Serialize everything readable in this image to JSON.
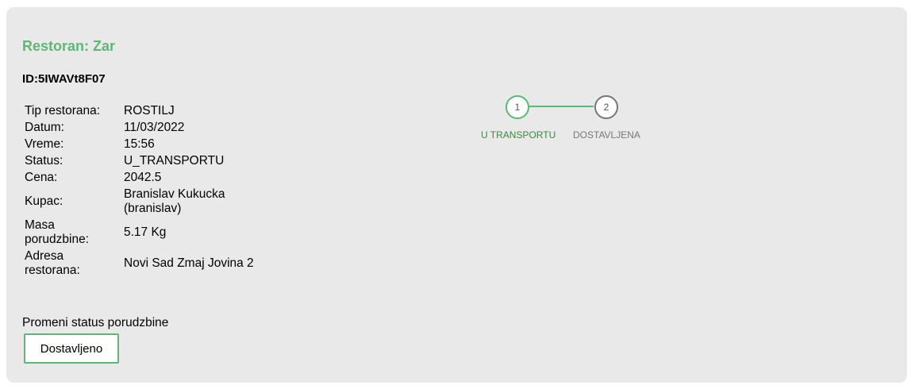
{
  "restaurant_title": "Restoran: Zar",
  "order_id": "ID:5IWAVt8F07",
  "details": [
    {
      "key": "Tip restorana:",
      "value": "ROSTILJ"
    },
    {
      "key": "Datum:",
      "value": "11/03/2022"
    },
    {
      "key": "Vreme:",
      "value": "15:56"
    },
    {
      "key": "Status:",
      "value": "U_TRANSPORTU"
    },
    {
      "key": "Cena:",
      "value": "2042.5"
    },
    {
      "key": "Kupac:",
      "value": "Branislav Kukucka (branislav)"
    },
    {
      "key": "Masa porudzbine:",
      "value": "5.17 Kg"
    },
    {
      "key": "Adresa restorana:",
      "value": "Novi Sad Zmaj Jovina 2"
    }
  ],
  "status_change": {
    "label": "Promeni status porudzbine",
    "button_label": "Dostavljeno"
  },
  "stepper": {
    "steps": [
      {
        "number": "1",
        "label": "U TRANSPORTU",
        "active": true
      },
      {
        "number": "2",
        "label": "DOSTAVLJENA",
        "active": false
      }
    ]
  },
  "colors": {
    "accent": "#5cb874",
    "card_background": "#e9e9e9",
    "inactive": "#777777"
  }
}
